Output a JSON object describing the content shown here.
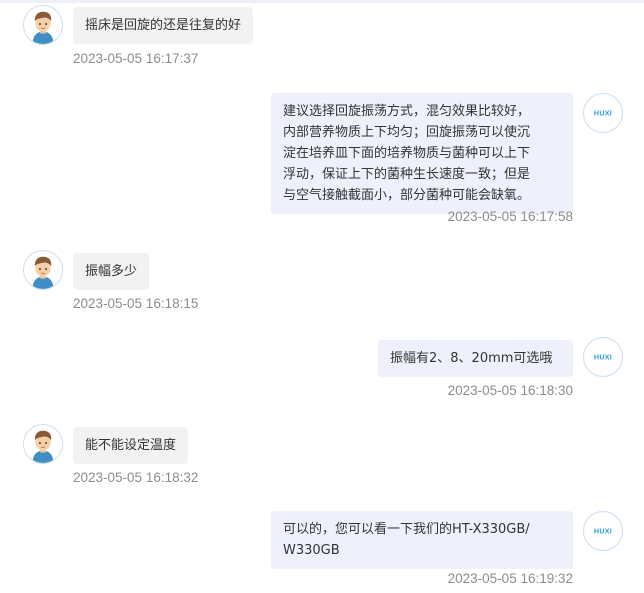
{
  "brand_color": "#2aa0e0",
  "bot_logo_text": "HUXI",
  "messages": [
    {
      "role": "user",
      "text": "摇床是回旋的还是往复的好",
      "time": "2023-05-05 16:17:37"
    },
    {
      "role": "bot",
      "lines": [
        "建议选择回旋振荡方式，混匀效果比较好，",
        "内部营养物质上下均匀；回旋振荡可以使沉",
        "淀在培养皿下面的培养物质与菌种可以上下",
        "浮动，保证上下的菌种生长速度一致；但是",
        "与空气接触截面小，部分菌种可能会缺氧。"
      ],
      "time": "2023-05-05 16:17:58"
    },
    {
      "role": "user",
      "text": "振幅多少",
      "time": "2023-05-05 16:18:15"
    },
    {
      "role": "bot",
      "lines": [
        "振幅有2、8、20mm可选哦"
      ],
      "time": "2023-05-05 16:18:30"
    },
    {
      "role": "user",
      "text": "能不能设定温度",
      "time": "2023-05-05 16:18:32"
    },
    {
      "role": "bot",
      "lines": [
        "可以的，您可以看一下我们的HT-X330GB/",
        "W330GB"
      ],
      "time": "2023-05-05 16:19:32"
    }
  ]
}
